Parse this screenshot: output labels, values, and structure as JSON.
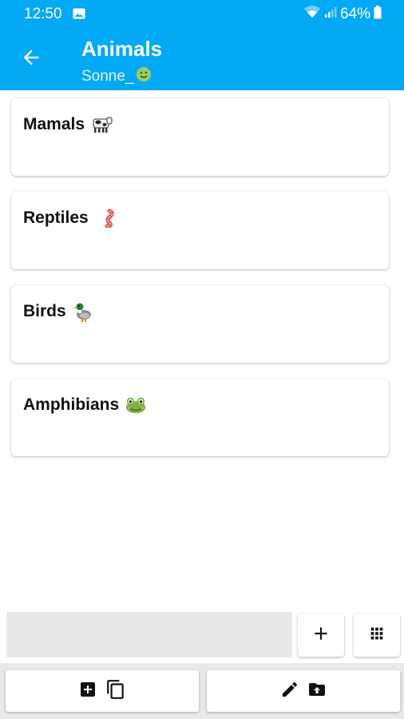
{
  "status_bar": {
    "time": "12:50",
    "battery": "64%"
  },
  "app_bar": {
    "title": "Animals",
    "subtitle": "Sonne_",
    "subtitle_emoji": "smiling-face",
    "background": "#03a9f4"
  },
  "categories": [
    {
      "label": "Mamals",
      "emoji": "cow"
    },
    {
      "label": "Reptiles",
      "emoji": "worm"
    },
    {
      "label": "Birds",
      "emoji": "duck"
    },
    {
      "label": "Amphibians",
      "emoji": "frog"
    }
  ],
  "input": {
    "value": ""
  },
  "icons": {
    "back": "arrow-left-icon",
    "add": "plus-icon",
    "grid": "grid-icon",
    "add_box": "add-box-icon",
    "copy": "copy-icon",
    "edit": "pencil-icon",
    "archive": "archive-icon"
  }
}
